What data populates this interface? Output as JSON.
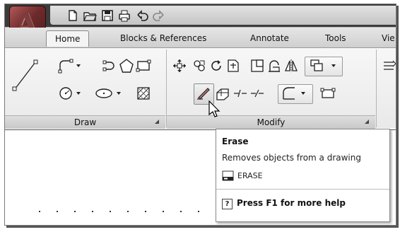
{
  "app": {
    "logo_letter": "A"
  },
  "quick_access": [
    "new-icon",
    "open-icon",
    "save-icon",
    "print-icon",
    "undo-icon",
    "redo-icon"
  ],
  "tabs": [
    {
      "label": "Home",
      "active": true
    },
    {
      "label": "Blocks & References",
      "active": false
    },
    {
      "label": "Annotate",
      "active": false
    },
    {
      "label": "Tools",
      "active": false
    },
    {
      "label": "Vie",
      "active": false
    }
  ],
  "panels": {
    "draw": {
      "title": "Draw"
    },
    "modify": {
      "title": "Modify"
    }
  },
  "tooltip": {
    "title": "Erase",
    "description": "Removes objects from a drawing",
    "command": "ERASE",
    "help": "Press F1 for more help",
    "help_icon": "?"
  },
  "colors": {
    "app_button": "#6e2a2a",
    "title_bar": "#3c3c3c",
    "ribbon": "#efefef"
  }
}
